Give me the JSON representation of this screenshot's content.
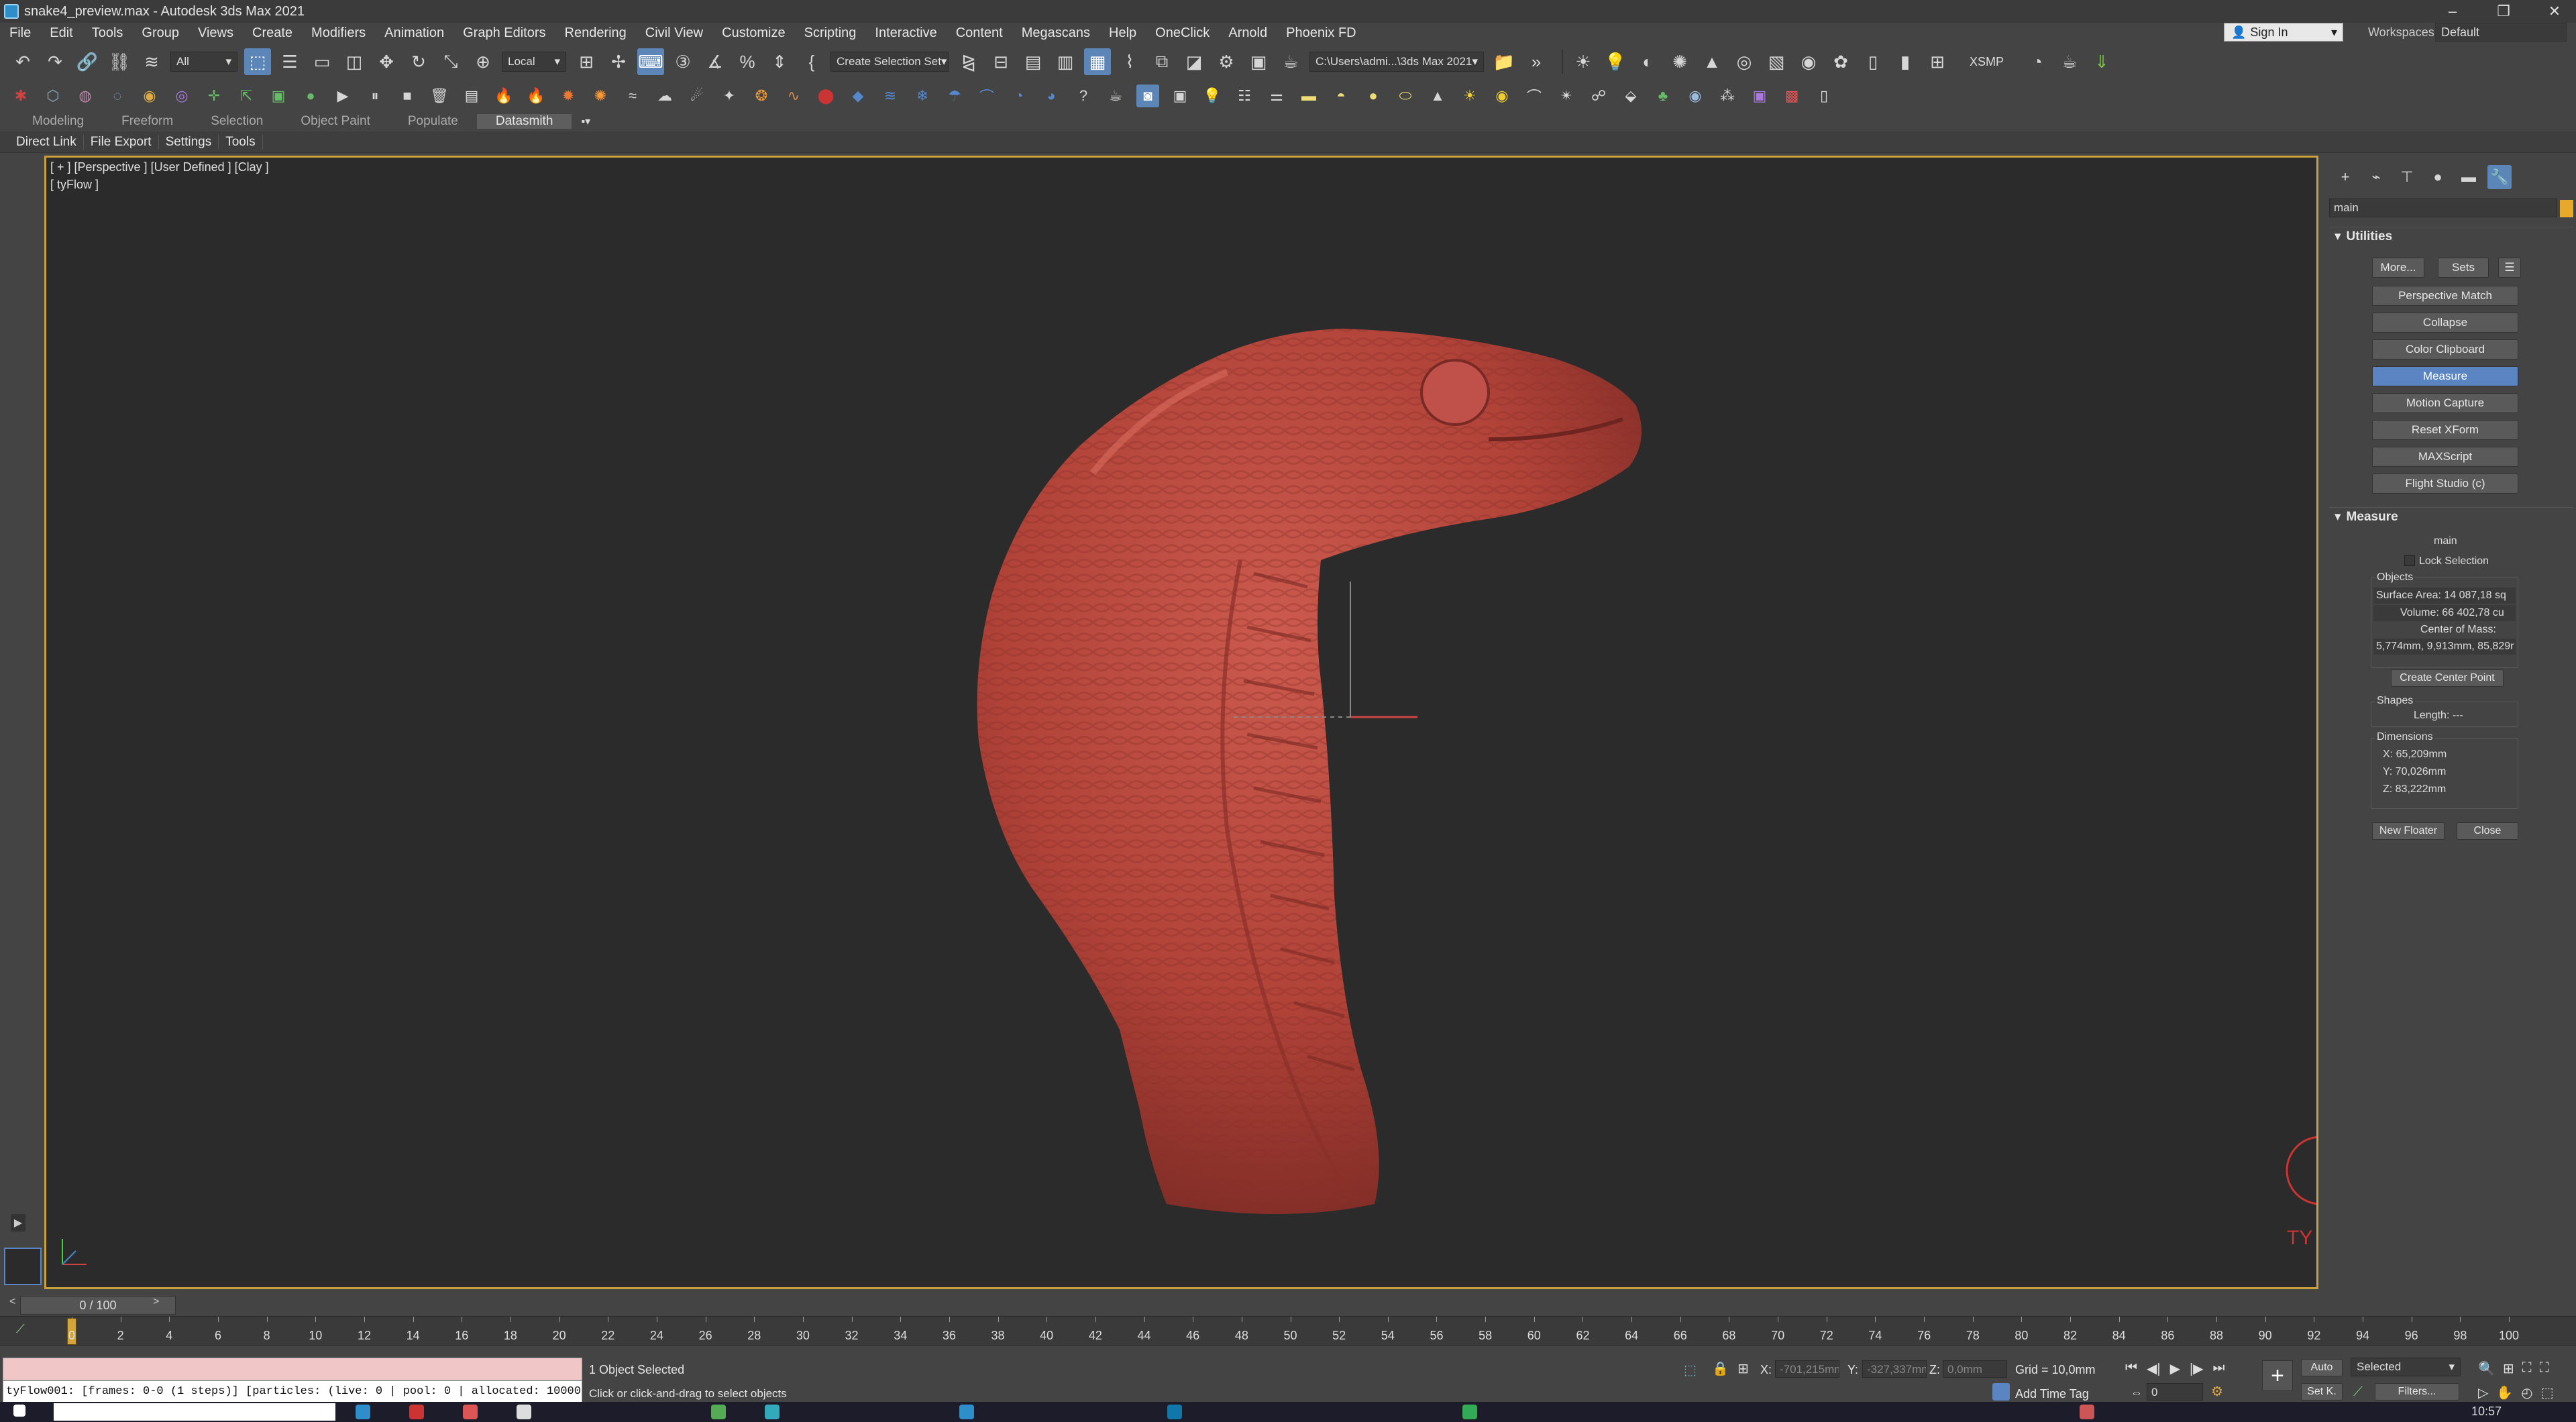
{
  "window": {
    "title": "snake4_preview.max - Autodesk 3ds Max 2021",
    "minimize": "–",
    "restore": "❐",
    "close": "✕"
  },
  "menu": {
    "items": [
      "File",
      "Edit",
      "Tools",
      "Group",
      "Views",
      "Create",
      "Modifiers",
      "Animation",
      "Graph Editors",
      "Rendering",
      "Civil View",
      "Customize",
      "Scripting",
      "Interactive",
      "Content",
      "Megascans",
      "Help",
      "OneClick",
      "Arnold",
      "Phoenix FD"
    ],
    "sign_in": "Sign In",
    "workspaces_label": "Workspaces:",
    "workspace_value": "Default"
  },
  "toolbar": {
    "selection_filter": "All",
    "ref_coord": "Local",
    "selection_set": "Create Selection Set",
    "project_path": "C:\\Users\\admi...\\3ds Max 2021",
    "xsmp": "XSMP"
  },
  "ribbon": {
    "tabs": [
      "Modeling",
      "Freeform",
      "Selection",
      "Object Paint",
      "Populate",
      "Datasmith"
    ],
    "active_tab": "Datasmith",
    "subtabs": [
      "Direct Link",
      "File Export",
      "Settings",
      "Tools"
    ]
  },
  "viewport": {
    "label": "[ + ] [Perspective ] [User Defined ] [Clay ]",
    "overlay": "[ tyFlow ]",
    "model_color": "#b8463d",
    "border_color": "#c8a03c"
  },
  "command_panel": {
    "object_name": "main",
    "object_color": "#e7a92c",
    "utilities": {
      "header": "Utilities",
      "more": "More...",
      "sets": "Sets",
      "buttons": [
        "Perspective Match",
        "Collapse",
        "Color Clipboard",
        "Measure",
        "Motion Capture",
        "Reset XForm",
        "MAXScript",
        "Flight Studio (c)"
      ],
      "active": "Measure"
    },
    "measure": {
      "header": "Measure",
      "object": "main",
      "lock_selection": "Lock Selection",
      "objects_group": "Objects",
      "surface_area": "Surface Area:  14 087,18 sq",
      "volume": "Volume:  66 402,78 cu",
      "center_of_mass_label": "Center of Mass:",
      "center_of_mass_value": "5,774mm, 9,913mm, 85,829r",
      "create_center_point": "Create Center Point",
      "shapes_group": "Shapes",
      "length": "Length:  ---",
      "dimensions_group": "Dimensions",
      "dim_x": "X:  65,209mm",
      "dim_y": "Y:  70,026mm",
      "dim_z": "Z:  83,222mm",
      "new_floater": "New Floater",
      "close": "Close"
    }
  },
  "timeline": {
    "slider": "0 / 100",
    "ticks": [
      "0",
      "2",
      "4",
      "6",
      "8",
      "10",
      "12",
      "14",
      "16",
      "18",
      "20",
      "22",
      "24",
      "26",
      "28",
      "30",
      "32",
      "34",
      "36",
      "38",
      "40",
      "42",
      "44",
      "46",
      "48",
      "50",
      "52",
      "54",
      "56",
      "58",
      "60",
      "62",
      "64",
      "66",
      "68",
      "70",
      "72",
      "74",
      "76",
      "78",
      "80",
      "82",
      "84",
      "86",
      "88",
      "90",
      "92",
      "94",
      "96",
      "98",
      "100"
    ]
  },
  "status": {
    "listener_output": "tyFlow001: [frames: 0-0 (1 steps)] [particles: (live: 0 | pool: 0 | allocated: 100000",
    "selection": "1 Object Selected",
    "prompt": "Click or click-and-drag to select objects",
    "x_label": "X:",
    "x_value": "-701,215mm",
    "y_label": "Y:",
    "y_value": "-327,337mm",
    "z_label": "Z:",
    "z_value": "0,0mm",
    "grid": "Grid = 10,0mm",
    "add_time_tag": "Add Time Tag",
    "auto_key": "Auto",
    "selected": "Selected",
    "set_key": "Set K.",
    "filters": "Filters...",
    "frame": "0",
    "clock": "10:57"
  }
}
